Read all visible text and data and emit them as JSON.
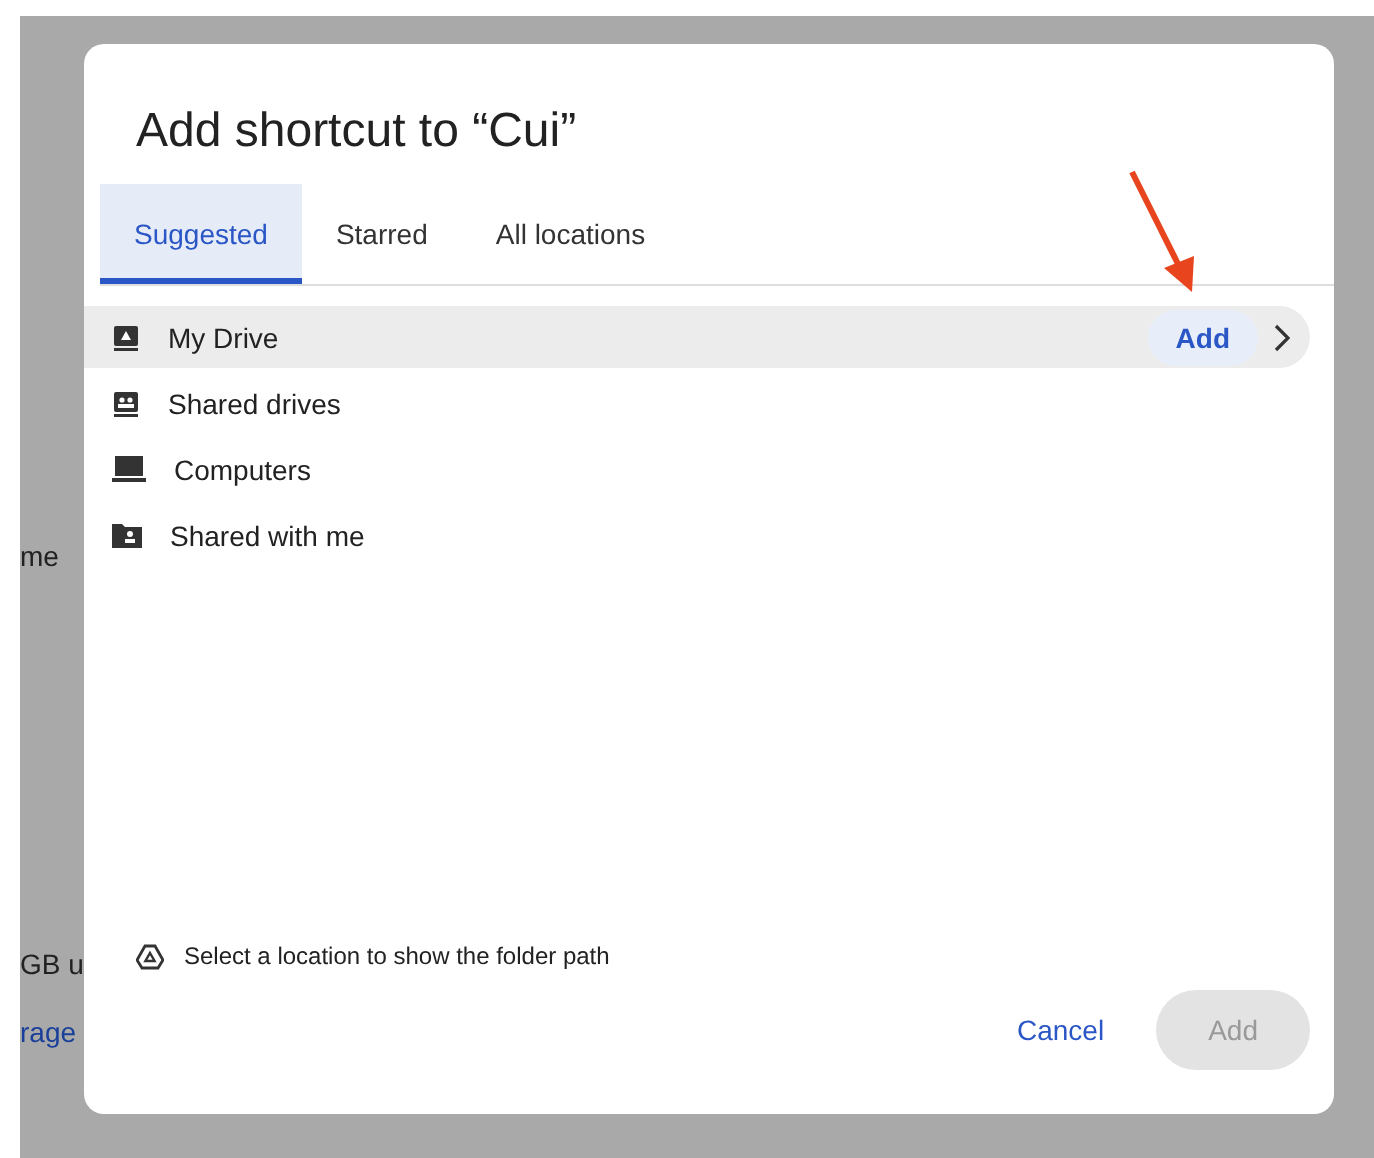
{
  "background": {
    "sidebar_texts": [
      "me",
      "GB u",
      "rage"
    ]
  },
  "dialog": {
    "title": "Add shortcut to “Cui”",
    "tabs": [
      {
        "label": "Suggested",
        "selected": true
      },
      {
        "label": "Starred",
        "selected": false
      },
      {
        "label": "All locations",
        "selected": false
      }
    ],
    "locations": [
      {
        "label": "My Drive",
        "kind": "drive",
        "selected": true,
        "action": "Add"
      },
      {
        "label": "Shared drives",
        "kind": "shared-drives",
        "selected": false
      },
      {
        "label": "Computers",
        "kind": "computer",
        "selected": false
      },
      {
        "label": "Shared with me",
        "kind": "shared-folder",
        "selected": false
      }
    ],
    "path_hint": "Select a location to show the folder path",
    "buttons": [
      {
        "label": "Cancel",
        "kind": "text",
        "disabled": false
      },
      {
        "label": "Add",
        "kind": "filled",
        "disabled": true
      }
    ]
  },
  "annotation": {
    "kind": "arrow"
  }
}
